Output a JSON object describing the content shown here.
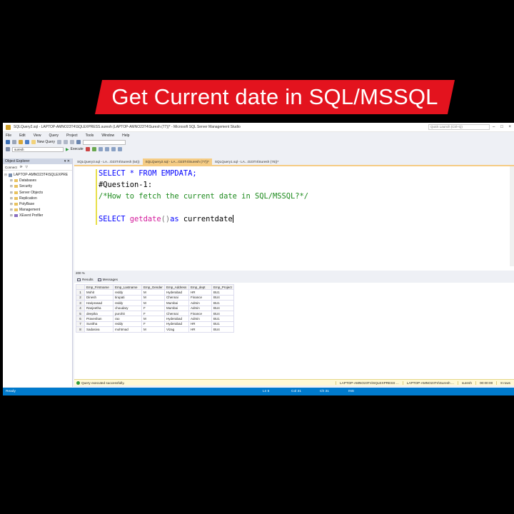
{
  "banner": {
    "text": "Get Current date in SQL/MSSQL"
  },
  "window": {
    "title": "SQLQuery2.sql - LAPTOP-AMNO23T4\\SQLEXPRESS.suresh (LAPTOP-AMNO23T4\\Suresh (77))* - Microsoft SQL Server Management Studio",
    "quick_launch": "Quick Launch (Ctrl+Q)"
  },
  "menu": [
    "File",
    "Edit",
    "View",
    "Query",
    "Project",
    "Tools",
    "Window",
    "Help"
  ],
  "toolbar": {
    "new_query": "New Query",
    "database": "suresh",
    "execute": "Execute"
  },
  "object_explorer": {
    "title": "Object Explorer",
    "connect": "Connect",
    "server": "LAPTOP-AMNO23T4\\SQLEXPRE",
    "nodes": [
      "Databases",
      "Security",
      "Server Objects",
      "Replication",
      "PolyBase",
      "Management",
      "XEvent Profiler"
    ]
  },
  "tabs": [
    {
      "label": "SQLQuery3.sql - LA...O23T4\\Suresh (54))"
    },
    {
      "label": "SQLQuery2.sql - LA...O23T4\\Suresh (77))*"
    },
    {
      "label": "SQLQuery1.sql - LA...O23T4\\Suresh (76))*"
    }
  ],
  "editor": {
    "line1_kw": "SELECT * FROM EMPDATA;",
    "line2": "#Question-1:",
    "line3": "/*How to fetch the current date in SQL/MSSQL?*/",
    "line4_kw1": "SELECT ",
    "line4_fn": "getdate",
    "line4_paren": "()",
    "line4_kw2": "as",
    "line4_tail": " currentdate"
  },
  "zoom": "200 %",
  "result_tabs": {
    "results": "Results",
    "messages": "Messages"
  },
  "results": {
    "columns": [
      "Emp_Firstname",
      "Emp_Lastname",
      "Emp_Gender",
      "Emp_Address",
      "Emp_dept",
      "Emp_Project"
    ],
    "rows": [
      [
        "1",
        "Mohit",
        "reddy",
        "M",
        "Hyderabad",
        "HR",
        "BU1"
      ],
      [
        "2",
        "Dinesh",
        "tirupati",
        "M",
        "Chennai",
        "Finance",
        "BU4"
      ],
      [
        "3",
        "Hariprasad",
        "reddy",
        "M",
        "Mumbai",
        "Admin",
        "BU1"
      ],
      [
        "4",
        "Ranjeetha",
        "choudary",
        "F",
        "Mumbai",
        "Admin",
        "BU4"
      ],
      [
        "5",
        "deepika",
        "purohit",
        "F",
        "Chennai",
        "Finance",
        "BU4"
      ],
      [
        "6",
        "Praveshan",
        "rao",
        "M",
        "Hyderabad",
        "Admin",
        "BU1"
      ],
      [
        "7",
        "Sunitha",
        "reddy",
        "F",
        "Hyderabad",
        "HR",
        "BU1"
      ],
      [
        "8",
        "Sadasiva",
        "mohtmad",
        "M",
        "Vizag",
        "HR",
        "BU4"
      ]
    ]
  },
  "status_strip": {
    "message": "Query executed successfully.",
    "server": "LAPTOP-AMNO23T4\\SQLEXPRESS ...",
    "login": "LAPTOP-AMNO23T4\\Suresh ...",
    "db": "suresh",
    "time": "00:00:00",
    "rows": "8 rows"
  },
  "statusbar": {
    "ready": "Ready",
    "ln": "Ln 5",
    "col": "Col 31",
    "ch": "Ch 31",
    "ins": "INS"
  },
  "colors": {
    "banner": "#e3131e",
    "statusbar": "#007acc",
    "active_tab": "#f5cc84"
  }
}
